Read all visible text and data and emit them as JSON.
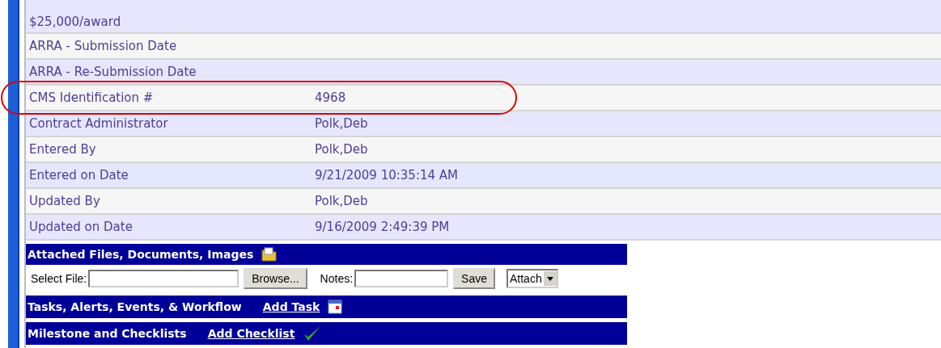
{
  "fields": [
    {
      "label": "$25,000/award"
    },
    {
      "label": "ARRA - Submission Date"
    },
    {
      "label": "ARRA - Re-Submission Date"
    },
    {
      "label": "CMS Identification #",
      "value": "4968"
    },
    {
      "label": "Contract Administrator",
      "value": "Polk,Deb"
    },
    {
      "label": "Entered By",
      "value": "Polk,Deb"
    },
    {
      "label": "Entered on Date",
      "value": "9/21/2009 10:35:14 AM"
    },
    {
      "label": "Updated By",
      "value": "Polk,Deb"
    },
    {
      "label": "Updated on Date",
      "value": "9/16/2009 2:49:39 PM"
    }
  ],
  "attachments": {
    "title": "Attached Files, Documents, Images",
    "file_label": "Select File:",
    "browse": "Browse...",
    "notes_label": "Notes:",
    "save": "Save",
    "action": "Attach"
  },
  "tasks": {
    "title": "Tasks, Alerts, Events, & Workflow",
    "link": "Add Task"
  },
  "milestones": {
    "title": "Milestone and Checklists",
    "link": "Add Checklist"
  }
}
